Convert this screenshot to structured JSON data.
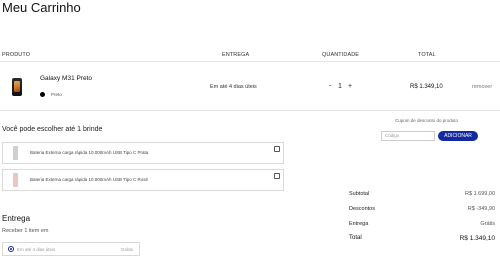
{
  "page": {
    "title": "Meu Carrinho"
  },
  "table": {
    "headers": {
      "product": "PRODUTO",
      "delivery": "ENTREGA",
      "quantity": "QUANTIDADE",
      "total": "TOTAL"
    }
  },
  "cart_item": {
    "name": "Galaxy M31 Preto",
    "color_label": "Preto",
    "color_hex": "#000000",
    "delivery": "Em até 4 dias úteis",
    "qty_minus": "-",
    "quantity": "1",
    "qty_plus": "+",
    "price": "R$ 1.349,10",
    "remove": "remover"
  },
  "gifts": {
    "heading": "Você pode escolher até 1 brinde",
    "items": [
      {
        "label": "Bateria Externa carga rápida 10.000mAh USB Tipo C Prata"
      },
      {
        "label": "Bateria Externa carga rápida 10.000mAh USB Tipo C Rosé"
      }
    ]
  },
  "coupon": {
    "label": "Cupom de desconto do produto",
    "placeholder": "Código",
    "button": "ADICIONAR"
  },
  "delivery": {
    "heading": "Entrega",
    "subheading": "Receber 1 item em",
    "option_label": "Em até 4 dias úteis",
    "option_price": "Grátis"
  },
  "summary": {
    "subtotal_label": "Subtotal",
    "subtotal_value": "R$ 1.699,00",
    "discount_label": "Descontos",
    "discount_value": "R$ -349,90",
    "shipping_label": "Entrega",
    "shipping_value": "Grátis",
    "total_label": "Total",
    "total_value": "R$ 1.349,10"
  },
  "colors": {
    "accent": "#1428a0"
  }
}
